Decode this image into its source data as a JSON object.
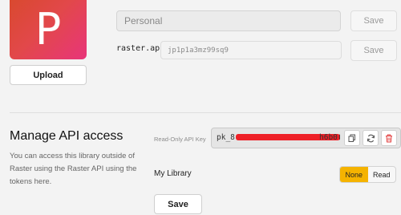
{
  "profile": {
    "avatar_letter": "P",
    "upload_label": "Upload",
    "name_value": "Personal",
    "save_label": "Save",
    "slug_prefix": "raster.app/",
    "slug_value": "jp1p1a3mz99sq9",
    "slug_save_label": "Save"
  },
  "api_section": {
    "title": "Manage API access",
    "description": "You can access this library outside of Raster using the Raster API using the tokens here.",
    "key_label": "Read-Only API Key",
    "key_prefix": "pk_8",
    "key_suffix": "h6b0(",
    "library_label": "My Library",
    "access_options": [
      "None",
      "Read"
    ],
    "selected_access": "None",
    "save_label": "Save"
  },
  "colors": {
    "accent": "#f5b300",
    "redaction": "#ee1f26",
    "delete": "#e23b3b"
  }
}
